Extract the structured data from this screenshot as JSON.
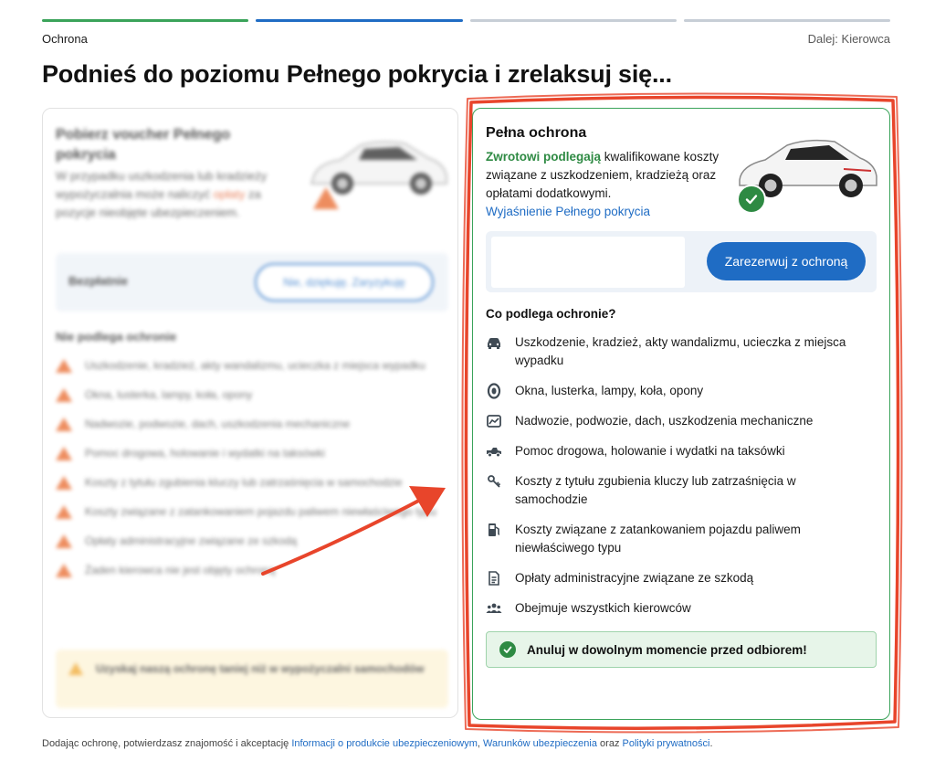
{
  "progress": {
    "steps": [
      "done",
      "active",
      "todo",
      "todo"
    ]
  },
  "step": {
    "current": "Ochrona",
    "next": "Dalej: Kierowca"
  },
  "page_title": "Podnieś do poziomu Pełnego pokrycia i zrelaksuj się...",
  "left_card": {
    "title": "Pobierz voucher Pełnego pokrycia",
    "desc_before": "W przypadku uszkodzenia lub kradzieży wypożyczalnia może naliczyć ",
    "desc_highlight": "opłaty",
    "desc_after": " za pozycje nieobjęte ubezpieczeniem.",
    "price_label": "Bezpłatnie",
    "decline_button": "Nie, dziękuję. Zaryzykuję",
    "list_heading": "Nie podlega ochronie",
    "items": [
      "Uszkodzenie, kradzież, akty wandalizmu, ucieczka z miejsca wypadku",
      "Okna, lusterka, lampy, koła, opony",
      "Nadwozie, podwozie, dach, uszkodzenia mechaniczne",
      "Pomoc drogowa, holowanie i wydatki na taksówki",
      "Koszty z tytułu zgubienia kluczy lub zatrzaśnięcia w samochodzie",
      "Koszty związane z zatankowaniem pojazdu paliwem niewłaściwego typu",
      "Opłaty administracyjne związane ze szkodą",
      "Żaden kierowca nie jest objęty ochroną"
    ],
    "note": "Uzyskaj naszą ochronę taniej niż w wypożyczalni samochodów"
  },
  "right_card": {
    "title": "Pełna ochrona",
    "desc_green": "Zwrotowi podlegają",
    "desc_rest": " kwalifikowane koszty związane z uszkodzeniem, kradzieżą oraz opłatami dodatkowymi.",
    "link": "Wyjaśnienie Pełnego pokrycia",
    "book_button": "Zarezerwuj z ochroną",
    "list_heading": "Co podlega ochronie?",
    "items": [
      {
        "icon": "car-icon",
        "text": "Uszkodzenie, kradzież, akty wandalizmu, ucieczka z miejsca wypadku"
      },
      {
        "icon": "tire-icon",
        "text": "Okna, lusterka, lampy, koła, opony"
      },
      {
        "icon": "car-body-icon",
        "text": "Nadwozie, podwozie, dach, uszkodzenia mechaniczne"
      },
      {
        "icon": "tow-truck-icon",
        "text": "Pomoc drogowa, holowanie i wydatki na taksówki"
      },
      {
        "icon": "keys-icon",
        "text": "Koszty z tytułu zgubienia kluczy lub zatrzaśnięcia w samochodzie"
      },
      {
        "icon": "fuel-pump-icon",
        "text": "Koszty związane z zatankowaniem pojazdu paliwem niewłaściwego typu"
      },
      {
        "icon": "document-icon",
        "text": "Opłaty administracyjne związane ze szkodą"
      },
      {
        "icon": "people-icon",
        "text": "Obejmuje wszystkich kierowców"
      }
    ],
    "cancel_note": "Anuluj w dowolnym momencie przed odbiorem!"
  },
  "footer": {
    "prefix": "Dodając ochronę, potwierdzasz znajomość i akceptację ",
    "link1": "Informacji o produkcie ubezpieczeniowym",
    "sep": ", ",
    "link2": "Warunków ubezpieczenia",
    "and": " oraz ",
    "link3": "Polityki prywatności",
    "suffix": "."
  },
  "colors": {
    "brand_blue": "#1f6cc4",
    "success_green": "#2e8a43",
    "warning_orange": "#e8672a",
    "annotation_red": "#e8452b"
  }
}
